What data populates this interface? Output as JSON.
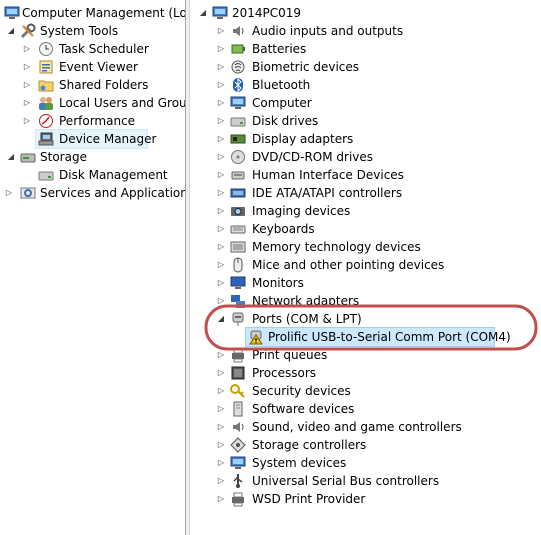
{
  "left_tree": {
    "root": "Computer Management (Local",
    "system_tools": "System Tools",
    "task_scheduler": "Task Scheduler",
    "event_viewer": "Event Viewer",
    "shared_folders": "Shared Folders",
    "local_users": "Local Users and Groups",
    "performance": "Performance",
    "device_manager": "Device Manager",
    "storage": "Storage",
    "disk_management": "Disk Management",
    "services": "Services and Applications"
  },
  "right_tree": {
    "computer": "2014PC019",
    "categories": [
      "Audio inputs and outputs",
      "Batteries",
      "Biometric devices",
      "Bluetooth",
      "Computer",
      "Disk drives",
      "Display adapters",
      "DVD/CD-ROM drives",
      "Human Interface Devices",
      "IDE ATA/ATAPI controllers",
      "Imaging devices",
      "Keyboards",
      "Memory technology devices",
      "Mice and other pointing devices",
      "Monitors",
      "Network adapters",
      "Ports (COM & LPT)",
      "Print queues",
      "Processors",
      "Security devices",
      "Software devices",
      "Sound, video and game controllers",
      "Storage controllers",
      "System devices",
      "Universal Serial Bus controllers",
      "WSD Print Provider"
    ],
    "port_child": "Prolific USB-to-Serial Comm Port (COM4)"
  },
  "colors": {
    "highlight_ellipse": "#c0504d",
    "selection": "#cce8ff",
    "warning": "#f2c200"
  }
}
